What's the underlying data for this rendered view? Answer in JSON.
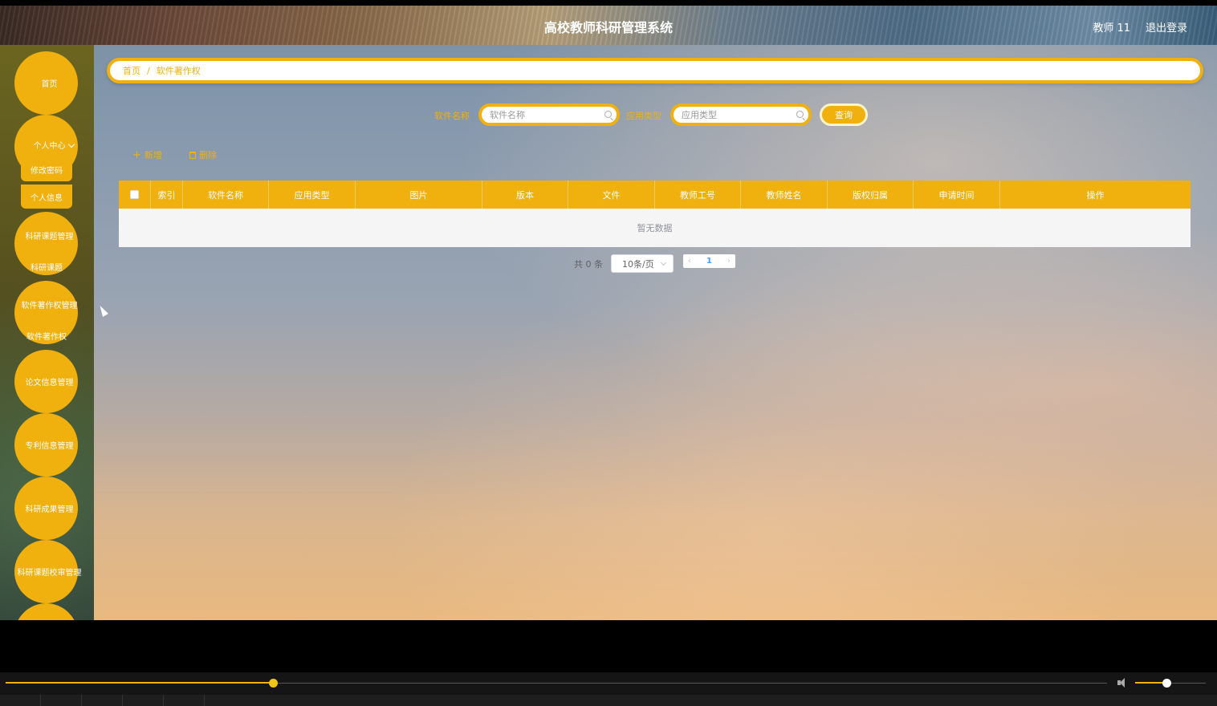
{
  "header": {
    "title": "高校教师科研管理系统",
    "user": "教师 11",
    "logout": "退出登录"
  },
  "sidebar": {
    "items": [
      {
        "label": "首页"
      },
      {
        "label": "个人中心",
        "children": [
          "修改密码",
          "个人信息"
        ]
      },
      {
        "label": "科研课题管理",
        "children": [
          "科研课题"
        ]
      },
      {
        "label": "软件著作权管理",
        "children": [
          "软件著作权"
        ]
      },
      {
        "label": "论文信息管理"
      },
      {
        "label": "专利信息管理"
      },
      {
        "label": "科研成果管理"
      },
      {
        "label": "科研课题校审管理"
      }
    ]
  },
  "breadcrumb": {
    "home": "首页",
    "separator": "/",
    "current": "软件著作权"
  },
  "search": {
    "name_label": "软件名称",
    "name_placeholder": "软件名称",
    "type_label": "应用类型",
    "type_placeholder": "应用类型",
    "query_button": "查询"
  },
  "actions": {
    "add": "新增",
    "delete": "删除"
  },
  "table": {
    "columns": [
      "索引",
      "软件名称",
      "应用类型",
      "图片",
      "版本",
      "文件",
      "教师工号",
      "教师姓名",
      "版权归属",
      "申请时间",
      "操作"
    ],
    "empty_text": "暂无数据"
  },
  "pagination": {
    "total": "共 0 条",
    "page_size": "10条/页",
    "current_page": "1"
  },
  "player": {
    "progress": 0.243,
    "volume": 0.44
  },
  "colors": {
    "accent": "#f0b00e"
  }
}
